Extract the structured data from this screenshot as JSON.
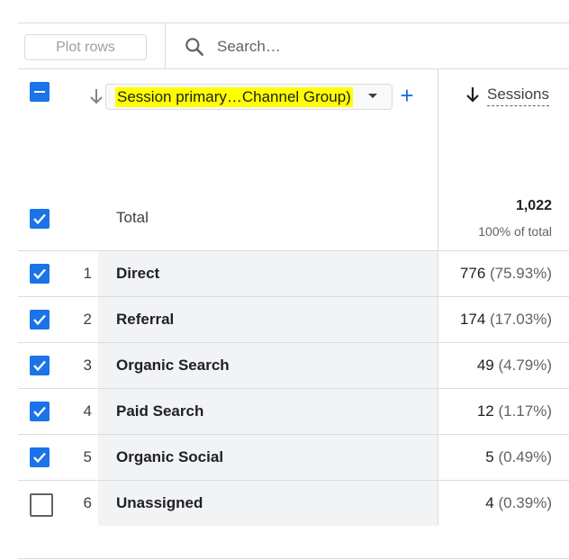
{
  "toolbar": {
    "plot_rows_label": "Plot rows",
    "search_placeholder": "Search…",
    "search_icon": "search-icon"
  },
  "header": {
    "dimension_label": "Session primary…Channel Group)",
    "add_dimension": "+",
    "metric_label": "Sessions",
    "highlight_color": "#ffff00"
  },
  "total": {
    "label": "Total",
    "value": "1,022",
    "pct": "100% of total"
  },
  "rows": [
    {
      "index": "1",
      "name": "Direct",
      "value": "776",
      "pct": "(75.93%)",
      "checked": true
    },
    {
      "index": "2",
      "name": "Referral",
      "value": "174",
      "pct": "(17.03%)",
      "checked": true
    },
    {
      "index": "3",
      "name": "Organic Search",
      "value": "49",
      "pct": "(4.79%)",
      "checked": true
    },
    {
      "index": "4",
      "name": "Paid Search",
      "value": "12",
      "pct": "(1.17%)",
      "checked": true
    },
    {
      "index": "5",
      "name": "Organic Social",
      "value": "5",
      "pct": "(0.49%)",
      "checked": true
    },
    {
      "index": "6",
      "name": "Unassigned",
      "value": "4",
      "pct": "(0.39%)",
      "checked": false
    }
  ],
  "colors": {
    "accent": "#1a73e8",
    "dimension_cell_bg": "#f1f3f4"
  }
}
